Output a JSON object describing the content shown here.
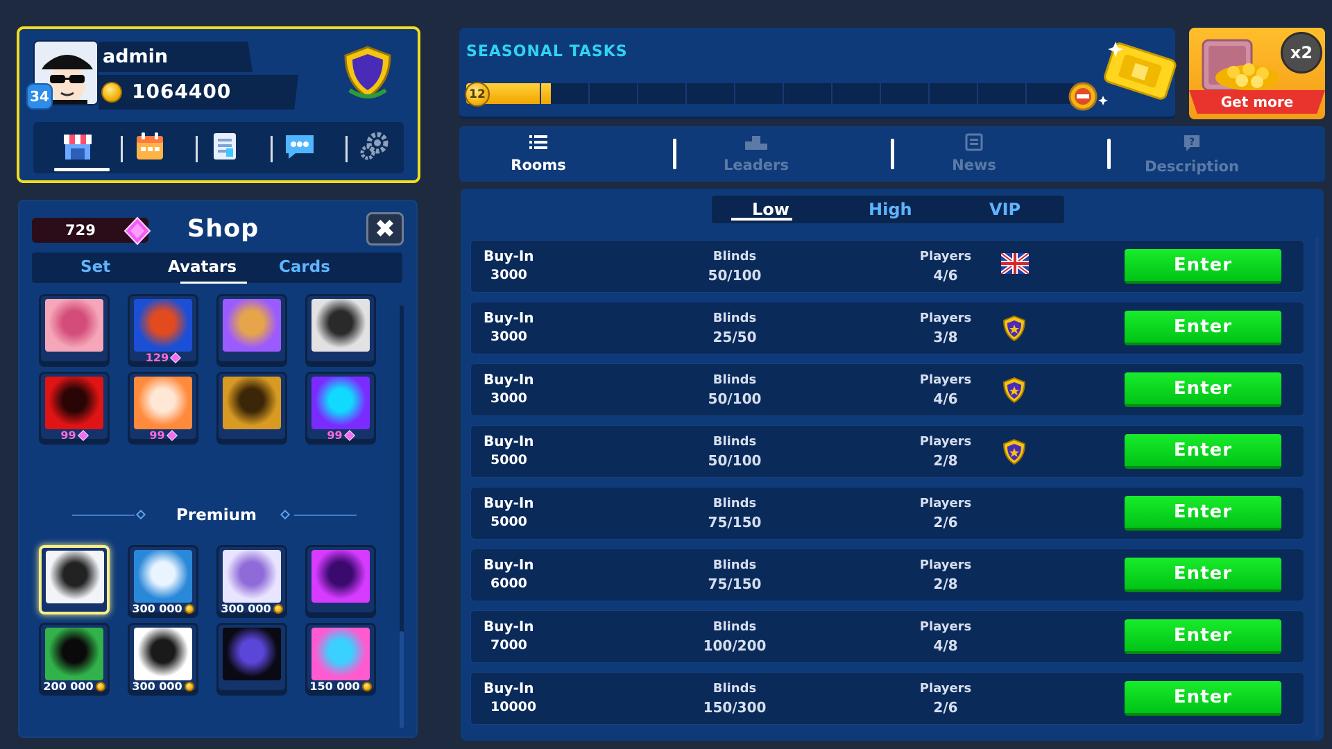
{
  "profile": {
    "username": "admin",
    "level": "34",
    "coins": "1064400",
    "nav": [
      {
        "name": "shop-nav-button",
        "icon": "shop-icon"
      },
      {
        "name": "calendar-nav-button",
        "icon": "calendar-icon"
      },
      {
        "name": "tasks-nav-button",
        "icon": "document-icon"
      },
      {
        "name": "chat-nav-button",
        "icon": "chat-icon"
      },
      {
        "name": "settings-nav-button",
        "icon": "gear-icon"
      }
    ]
  },
  "shop": {
    "title": "Shop",
    "gems": "729",
    "close_label": "✖",
    "tabs": [
      "Set",
      "Avatars",
      "Cards"
    ],
    "active_tab": "Avatars",
    "premium_label": "Premium",
    "avatars_top": [
      {
        "price": "",
        "currency": "",
        "colors": [
          "#f5a6b8",
          "#d44d7a"
        ]
      },
      {
        "price": "129",
        "currency": "gem",
        "colors": [
          "#1b4fd6",
          "#e24a1f"
        ]
      },
      {
        "price": "",
        "currency": "",
        "colors": [
          "#9b5bff",
          "#e6a54a"
        ]
      },
      {
        "price": "",
        "currency": "",
        "colors": [
          "#e2e2e2",
          "#2a2a2a"
        ]
      },
      {
        "price": "99",
        "currency": "gem",
        "colors": [
          "#e01414",
          "#2a0505"
        ]
      },
      {
        "price": "99",
        "currency": "gem",
        "colors": [
          "#ff8a3c",
          "#ffe7d6"
        ]
      },
      {
        "price": "",
        "currency": "",
        "colors": [
          "#d89a22",
          "#3b2607"
        ]
      },
      {
        "price": "99",
        "currency": "gem",
        "colors": [
          "#7a2cff",
          "#11d9ff"
        ]
      }
    ],
    "avatars_premium": [
      {
        "price": "",
        "currency": "",
        "colors": [
          "#f2f4f8",
          "#222222"
        ],
        "selected": true
      },
      {
        "price": "300 000",
        "currency": "coin",
        "colors": [
          "#2a88d8",
          "#e8f4ff"
        ]
      },
      {
        "price": "300 000",
        "currency": "coin",
        "colors": [
          "#e9e4ff",
          "#8e6bd8"
        ]
      },
      {
        "price": "",
        "currency": "",
        "colors": [
          "#d63bff",
          "#3a0a6e"
        ]
      },
      {
        "price": "200 000",
        "currency": "coin",
        "colors": [
          "#32b24a",
          "#0a0a0a"
        ]
      },
      {
        "price": "300 000",
        "currency": "coin",
        "colors": [
          "#ffffff",
          "#1a1a1a"
        ]
      },
      {
        "price": "",
        "currency": "",
        "colors": [
          "#0a0a14",
          "#5a46d8"
        ]
      },
      {
        "price": "150 000",
        "currency": "coin",
        "colors": [
          "#ff5bd0",
          "#3ad0ff"
        ]
      }
    ]
  },
  "seasonal": {
    "title": "SEASONAL TASKS",
    "level": "12",
    "progress": 0.125,
    "segments": 13
  },
  "get_more": {
    "label": "Get more",
    "multiplier": "x2"
  },
  "main_tabs": [
    {
      "label": "Rooms",
      "icon": "list-icon",
      "active": true
    },
    {
      "label": "Leaders",
      "icon": "podium-icon",
      "active": false
    },
    {
      "label": "News",
      "icon": "news-icon",
      "active": false
    },
    {
      "label": "Description",
      "icon": "help-icon",
      "active": false
    }
  ],
  "rooms": {
    "level_tabs": [
      "Low",
      "High",
      "VIP"
    ],
    "active_level": "Low",
    "labels": {
      "buyin": "Buy-In",
      "blinds": "Blinds",
      "players": "Players",
      "enter": "Enter"
    },
    "rows": [
      {
        "buyin": "3000",
        "blinds": "50/100",
        "players": "4/6",
        "icon": "uk-flag-icon"
      },
      {
        "buyin": "3000",
        "blinds": "25/50",
        "players": "3/8",
        "icon": "clan-shield-icon"
      },
      {
        "buyin": "3000",
        "blinds": "50/100",
        "players": "4/6",
        "icon": "clan-shield-icon"
      },
      {
        "buyin": "5000",
        "blinds": "50/100",
        "players": "2/8",
        "icon": "clan-shield-icon"
      },
      {
        "buyin": "5000",
        "blinds": "75/150",
        "players": "2/6",
        "icon": ""
      },
      {
        "buyin": "6000",
        "blinds": "75/150",
        "players": "2/8",
        "icon": ""
      },
      {
        "buyin": "7000",
        "blinds": "100/200",
        "players": "4/8",
        "icon": ""
      },
      {
        "buyin": "10000",
        "blinds": "150/300",
        "players": "2/6",
        "icon": ""
      }
    ]
  },
  "colors": {
    "panel": "#0f3a7a",
    "accent_yellow": "#f3dc1e",
    "enter_green": "#00c316",
    "tab_blue": "#5fb4ff"
  }
}
